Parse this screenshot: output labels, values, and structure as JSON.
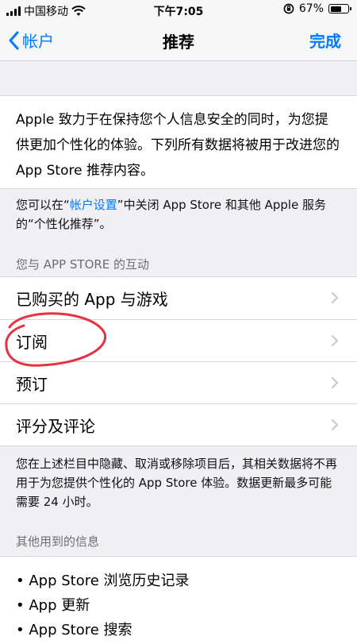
{
  "status_bar": {
    "carrier": "中国移动",
    "time": "下午7:05",
    "battery": "67%",
    "battery_level": 0.67
  },
  "nav": {
    "back_label": "帐户",
    "title": "推荐",
    "done_label": "完成"
  },
  "intro": {
    "text": "Apple 致力于在保持您个人信息安全的同时，为您提供更加个性化的体验。下列所有数据将被用于改进您的 App Store 推荐内容。"
  },
  "settings_note": {
    "prefix": "您可以在“",
    "link": "帐户设置",
    "suffix": "”中关闭 App Store 和其他 Apple 服务的“个性化推荐”。"
  },
  "interactions": {
    "header": "您与 APP STORE 的互动",
    "items": [
      {
        "label": "已购买的 App 与游戏"
      },
      {
        "label": "订阅"
      },
      {
        "label": "预订"
      },
      {
        "label": "评分及评论"
      }
    ],
    "footer": "您在上述栏目中隐藏、取消或移除项目后，其相关数据将不再用于为您提供个性化的 App Store 体验。数据更新最多可能需要 24 小时。"
  },
  "other_info": {
    "header": "其他用到的信息",
    "items": [
      "App Store 浏览历史记录",
      "App 更新",
      "App Store 搜索"
    ]
  },
  "colors": {
    "accent": "#007aff",
    "annotation": "#e8303f"
  }
}
